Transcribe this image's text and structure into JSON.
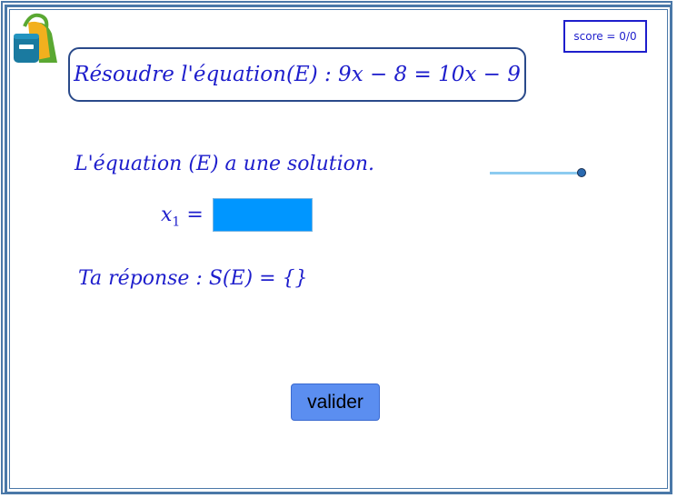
{
  "header": {
    "logo_icon": "backpack-icon",
    "score_text": "score = 0/0"
  },
  "problem": {
    "title": "Résoudre l'équation(E) : 9x − 8 = 10x − 9"
  },
  "main": {
    "statement": "L'équation (E) a une solution.",
    "x_label": "x",
    "x_subscript": "1",
    "x_equals": " =",
    "answer_value": "",
    "response_text": "Ta réponse : S(E) = {}"
  },
  "slider": {
    "value": 1.0
  },
  "actions": {
    "validate_label": "valider"
  },
  "colors": {
    "text_blue": "#1e1ecc",
    "input_blue": "#0096ff",
    "button_blue": "#5b8ef0",
    "frame_blue": "#4a78a8"
  }
}
